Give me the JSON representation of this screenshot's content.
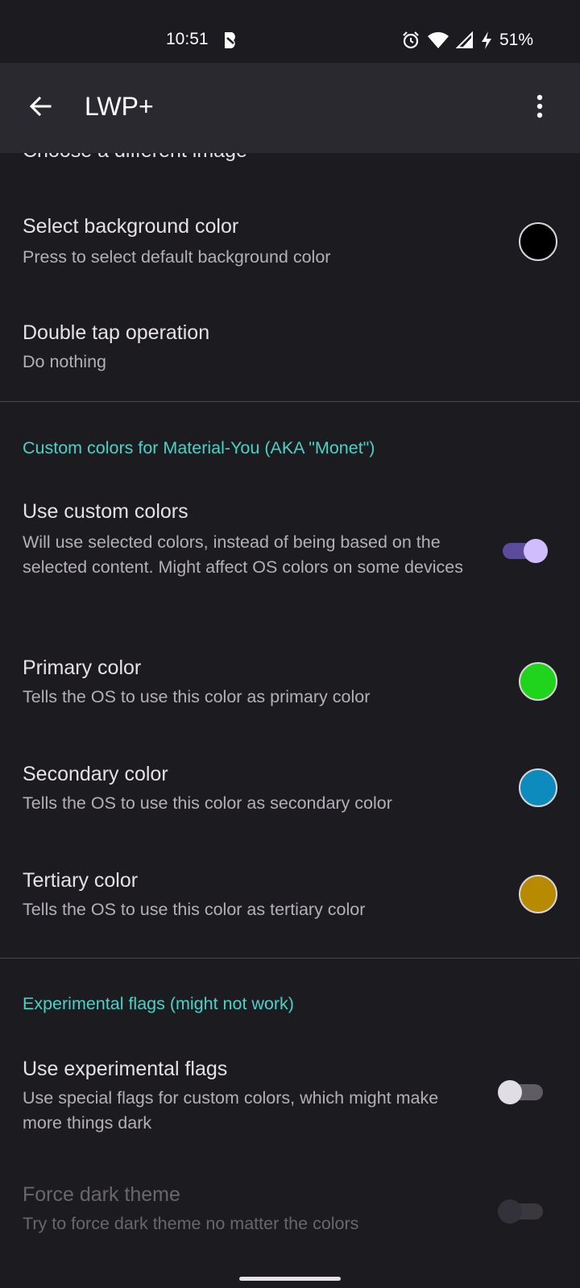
{
  "status_bar": {
    "time": "10:51",
    "battery": "51%",
    "icons": [
      "app-notification-icon",
      "alarm-icon",
      "wifi-icon",
      "cell-signal-icon",
      "charging-bolt-icon"
    ]
  },
  "app_bar": {
    "title": "LWP+",
    "back_icon": "arrow-left-icon",
    "menu_icon": "more-vert-icon"
  },
  "preferences": {
    "choose_image": {
      "title": "Choose a different image"
    },
    "background_color": {
      "title": "Select background color",
      "summary": "Press to select default background color",
      "color": "#000000"
    },
    "double_tap": {
      "title": "Double tap operation",
      "summary": "Do nothing"
    },
    "monet_category": "Custom colors for Material-You (AKA \"Monet\")",
    "use_custom_colors": {
      "title": "Use custom colors",
      "summary": "Will use selected colors, instead of being based on the selected content. Might affect OS colors on some devices",
      "checked": true
    },
    "primary_color": {
      "title": "Primary color",
      "summary": "Tells the OS to use this color as primary color",
      "color": "#1fd41a"
    },
    "secondary_color": {
      "title": "Secondary color",
      "summary": "Tells the OS to use this color as secondary color",
      "color": "#0d8bbd"
    },
    "tertiary_color": {
      "title": "Tertiary color",
      "summary": "Tells the OS to use this color as tertiary color",
      "color": "#b88a00"
    },
    "experimental_category": "Experimental flags (might not work)",
    "use_experimental_flags": {
      "title": "Use experimental flags",
      "summary": "Use special flags for custom colors, which might make more things dark",
      "checked": false
    },
    "force_dark_theme": {
      "title": "Force dark theme",
      "summary": "Try to force dark theme no matter the colors",
      "checked": false,
      "enabled": false
    }
  },
  "colors": {
    "background": "#1c1b20",
    "app_bar": "#2b2930",
    "accent": "#4dd0c6",
    "switch_on_thumb": "#d0bcff",
    "switch_on_track": "#5b4b9a"
  }
}
